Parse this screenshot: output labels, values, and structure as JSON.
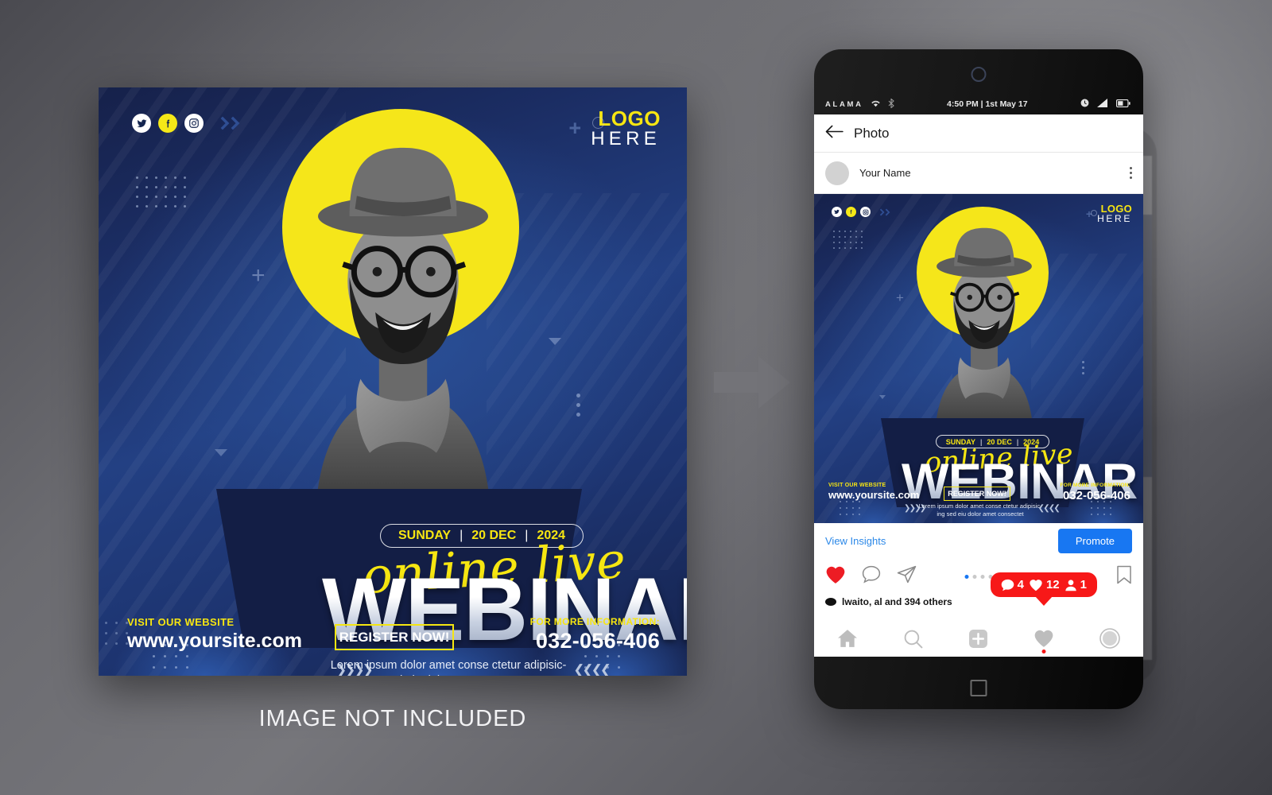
{
  "caption": "IMAGE NOT INCLUDED",
  "poster": {
    "logo_top": "LOGO",
    "logo_bottom": "HERE",
    "plus": "+",
    "date": {
      "day": "SUNDAY",
      "date": "20 DEC",
      "year": "2024",
      "sep": "|"
    },
    "script": "online live",
    "headline": "WEBINAR",
    "lorem_line1": "Lorem ipsum dolor amet conse ctetur adipisic-",
    "lorem_line2": "ing sed eiu dolor amet consectet",
    "arrows_left": "❯❯❯❯",
    "arrows_right": "❮❮❮❮",
    "website_caption": "VISIT OUR WEBSITE",
    "website_value": "www.yoursite.com",
    "register_label": "REGISTER NOW!",
    "info_caption": "FOR MORE INFORMATION:",
    "info_value": "032-056-406",
    "social": [
      "twitter-icon",
      "facebook-icon",
      "instagram-icon"
    ],
    "colors": {
      "yellow": "#F5E611",
      "deep_blue": "#16214a",
      "mid_blue": "#234083",
      "white": "#ffffff"
    }
  },
  "phone": {
    "status": {
      "carrier": "ALAMA",
      "time": "4:50 PM | 1st May 17",
      "icons_left": [
        "wifi-icon",
        "bluetooth-icon"
      ],
      "icons_right": [
        "clock-icon",
        "signal-icon",
        "battery-icon"
      ]
    },
    "appbar": {
      "back": "back-arrow-icon",
      "title": "Photo"
    },
    "user": {
      "name": "Your Name",
      "menu": "kebab-menu-icon"
    },
    "insights": {
      "link": "View Insights",
      "promote": "Promote"
    },
    "actions": {
      "like": "heart-filled-icon",
      "comment": "comment-icon",
      "share": "share-icon",
      "bookmark": "bookmark-icon",
      "carousel_dots": 4,
      "carousel_active": 0
    },
    "badge": {
      "comments": "4",
      "likes": "12",
      "follows": "1"
    },
    "likes_text": "lwaito, al  and 394 others",
    "nav": [
      "home-icon",
      "search-icon",
      "add-icon",
      "heart-icon",
      "profile-icon"
    ],
    "accent": "#1877F2",
    "badge_color": "#F71818"
  }
}
